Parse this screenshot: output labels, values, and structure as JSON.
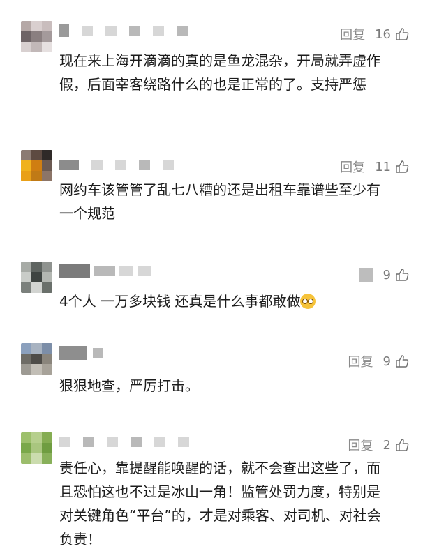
{
  "reply_label": "回复",
  "comments": [
    {
      "likes": "16",
      "text": "现在来上海开滴滴的真的是鱼龙混杂，开局就弄虚作假，后面宰客绕路什么的也是正常的了。支持严惩"
    },
    {
      "likes": "11",
      "text": "网约车该管管了乱七八糟的还是出租车靠谱些至少有一个规范"
    },
    {
      "likes": "9",
      "text": "4个人 一万多块钱  还真是什么事都敢做"
    },
    {
      "likes": "9",
      "text": "狠狠地查，严厉打击。"
    },
    {
      "likes": "2",
      "text": "责任心，靠提醒能唤醒的话，就不会查出这些了，而且恐怕这也不过是冰山一角！监管处罚力度，特别是对关键角色“平台”的，才是对乘客、对司机、对社会负责！"
    }
  ],
  "emoji_icon": "dizzy-face-emoji",
  "colors": {
    "text": "#1c1c1c",
    "meta": "#8a8a8a"
  }
}
